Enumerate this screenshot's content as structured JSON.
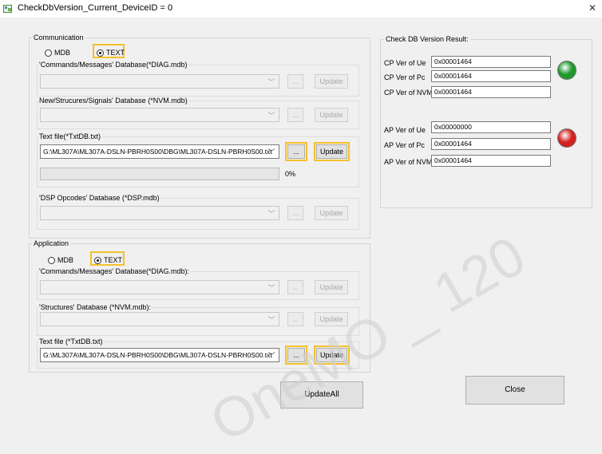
{
  "window": {
    "title": "CheckDbVersion_Current_DeviceID = 0",
    "close_glyph": "✕"
  },
  "communication": {
    "title": "Communication",
    "radio_mdb": "MDB",
    "radio_text": "TEXT",
    "selected": "TEXT",
    "commands_label": "'Commands/Messages' Database(*DIAG.mdb)",
    "nvm_label": "New/Strucures/Signals' Database (*NVM.mdb)",
    "textfile_label": "Text file(*TxtDB.txt)",
    "textfile_value": "G:\\ML307A\\ML307A-DSLN-PBRH0S00\\DBG\\ML307A-DSLN-PBRH0S00.txt",
    "progress_percent": 0,
    "progress_label": "0%",
    "dsp_label": "'DSP Opcodes' Database (*DSP.mdb)"
  },
  "application": {
    "title": "Application",
    "radio_mdb": "MDB",
    "radio_text": "TEXT",
    "selected": "TEXT",
    "commands_label": "'Commands/Messages' Database(*DIAG.mdb):",
    "structures_label": "'Structures' Database (*NVM.mdb):",
    "textfile_label": "Text file (*TxtDB.txt)",
    "textfile_value": "G:\\ML307A\\ML307A-DSLN-PBRH0S00\\DBG\\ML307A-DSLN-PBRH0S00.txt"
  },
  "buttons": {
    "browse": "...",
    "update": "Update",
    "update_all": "UpdateAll",
    "close": "Close"
  },
  "result": {
    "title": "Check DB Version Result:",
    "cp_ue_label": "CP Ver of Ue",
    "cp_ue_value": "0x00001464",
    "cp_pc_label": "CP Ver of Pc",
    "cp_pc_value": "0x00001464",
    "cp_nvm_label": "CP Ver of NVM",
    "cp_nvm_value": "0x00001464",
    "cp_status_color": "#1f9a2c",
    "ap_ue_label": "AP Ver of Ue",
    "ap_ue_value": "0x00000000",
    "ap_pc_label": "AP Ver of Pc",
    "ap_pc_value": "0x00001464",
    "ap_nvm_label": "AP Ver of NVM",
    "ap_nvm_value": "0x00001464",
    "ap_status_color": "#d42020"
  },
  "icons": {
    "combo_arrow": "chevron-down-icon",
    "window_icon": "app-icon",
    "close": "close-icon"
  },
  "colors": {
    "highlight": "#f5c02a",
    "background": "#f0f0f0"
  }
}
